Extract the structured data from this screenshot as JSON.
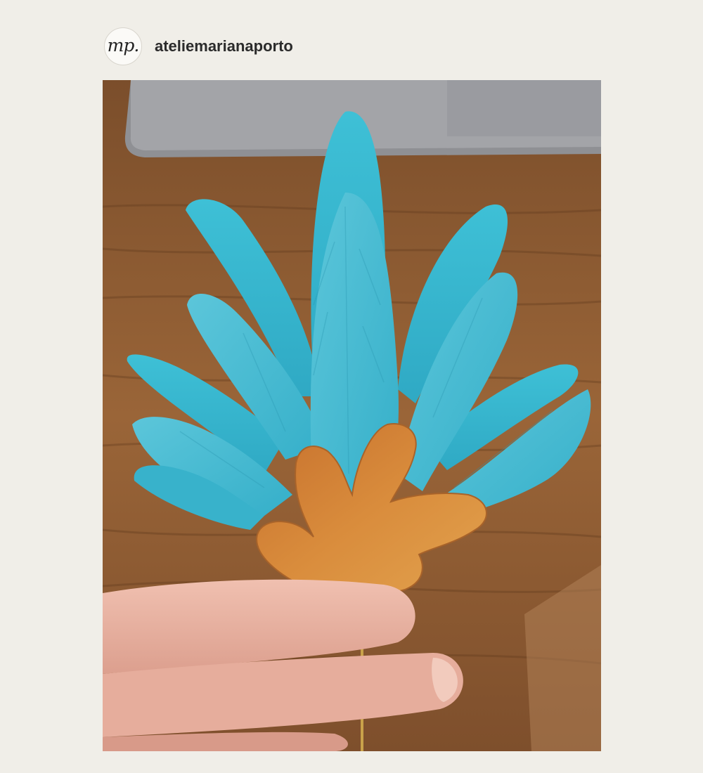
{
  "post": {
    "account": {
      "avatar_text": "mp.",
      "username": "ateliemarianaporto"
    },
    "image": {
      "subject": "turquoise-polymer-flower-brooch-on-pin"
    }
  },
  "colors": {
    "background": "#f0eee8",
    "turquoise": "#3cb7cf",
    "gold": "#cf8a3a",
    "wood": "#8a5a32"
  }
}
